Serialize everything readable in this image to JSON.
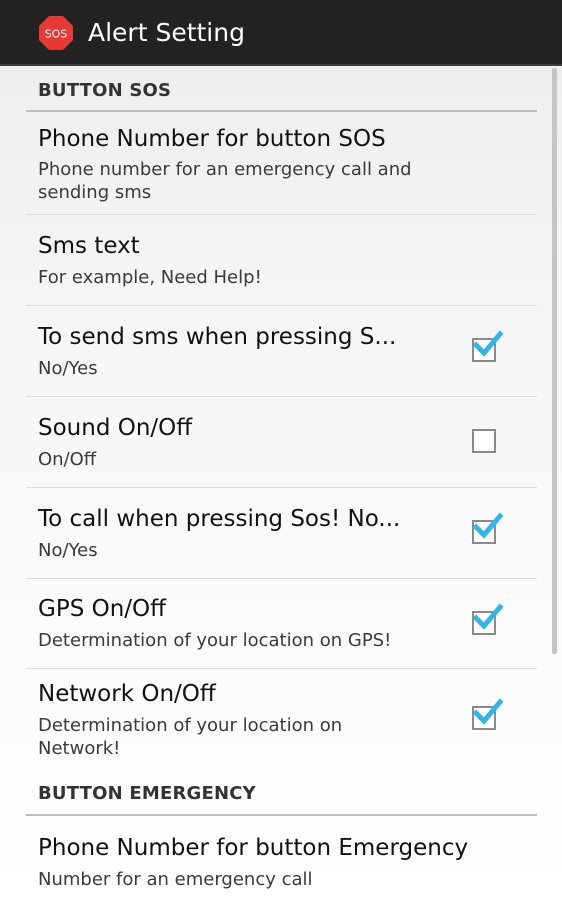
{
  "action_bar": {
    "app_icon": {
      "name": "sos-octagon-icon",
      "text": "SOS",
      "color": "#e53935"
    },
    "title": "Alert Setting"
  },
  "colors": {
    "action_bar": "#222222",
    "checkmark": "#33b5e5"
  },
  "categories": [
    {
      "label": "BUTTON SOS"
    },
    {
      "label": "BUTTON EMERGENCY"
    }
  ],
  "preferences": [
    {
      "title": "Phone Number for button SOS",
      "summary": "Phone number for an emergency call and sending sms"
    },
    {
      "title": "Sms text",
      "summary": "For example, Need Help!"
    },
    {
      "title": "To send sms when pressing S...",
      "summary": "No/Yes",
      "checked": true
    },
    {
      "title": "Sound On/Off",
      "summary": "On/Off",
      "checked": false
    },
    {
      "title": "To call when pressing Sos! No...",
      "summary": "No/Yes",
      "checked": true
    },
    {
      "title": "GPS On/Off",
      "summary": "Determination of your location on GPS!",
      "checked": true
    },
    {
      "title": "Network On/Off",
      "summary": "Determination of your location on Network!",
      "checked": true
    },
    {
      "title": "Phone Number for button Emergency",
      "summary": "Number for an emergency call"
    }
  ]
}
